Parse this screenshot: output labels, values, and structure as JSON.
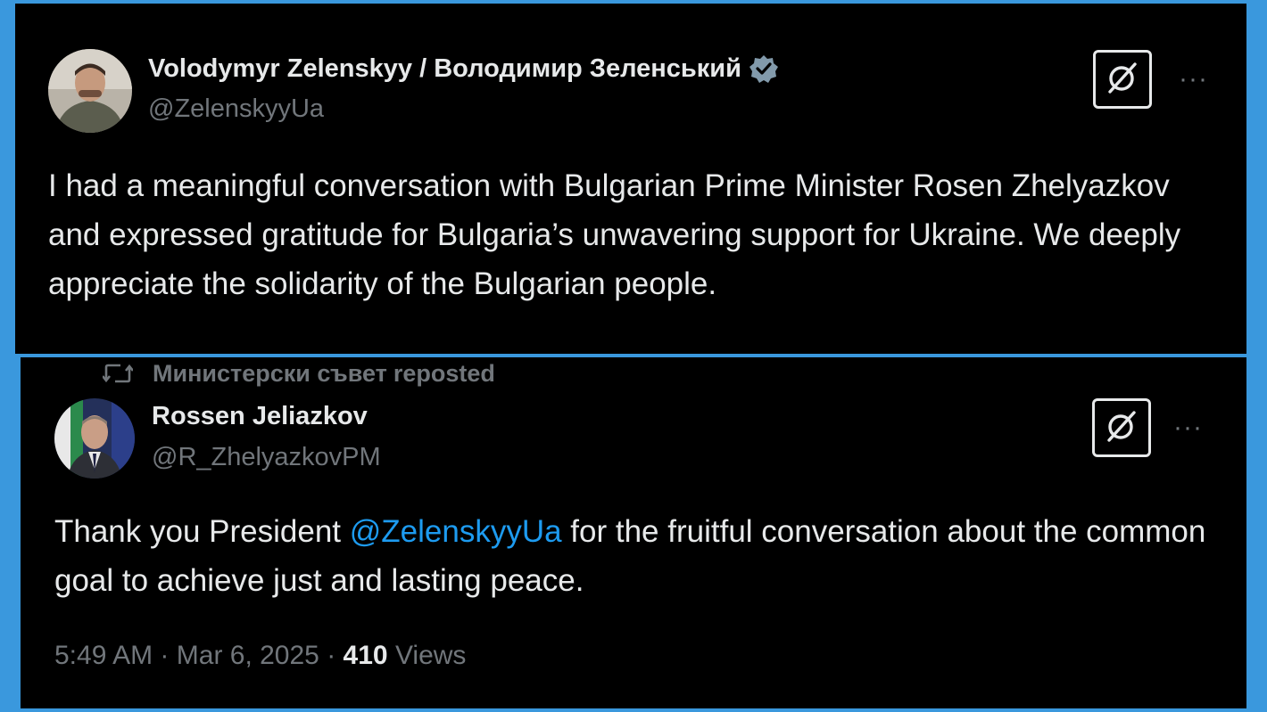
{
  "tweet": {
    "author_name": "Volodymyr Zelenskyy / Володимир Зеленський",
    "author_handle": "@ZelenskyyUa",
    "verified": true,
    "text": "I had a meaningful conversation with Bulgarian Prime Minister Rosen Zhelyazkov and expressed gratitude for Bulgaria’s unwavering support for Ukraine. We deeply appreciate the solidarity of the Bulgarian people.",
    "more_label": "···",
    "icons": [
      "verified-badge-icon",
      "grok-icon",
      "more-icon"
    ]
  },
  "repost": {
    "reposter": "Министерски съвет",
    "reposted_label": "reposted",
    "author_name": "Rossen Jeliazkov",
    "author_handle": "@R_ZhelyazkovPM",
    "text_before": "Thank you President ",
    "mention": "@ZelenskyyUa",
    "text_after": " for the fruitful conversation about the common goal to achieve just and lasting peace.",
    "time": "5:49 AM",
    "separator": "·",
    "date": "Mar 6, 2025",
    "views_count": "410",
    "views_label": "Views",
    "more_label": "···",
    "icons": [
      "repost-icon",
      "grok-icon",
      "more-icon"
    ]
  },
  "colors": {
    "background_frame": "#3a98dd",
    "panel": "#000000",
    "text_primary": "#e7e9ea",
    "text_secondary": "#71767b",
    "mention": "#1d9bf0",
    "verified_badge": "#829aab"
  }
}
